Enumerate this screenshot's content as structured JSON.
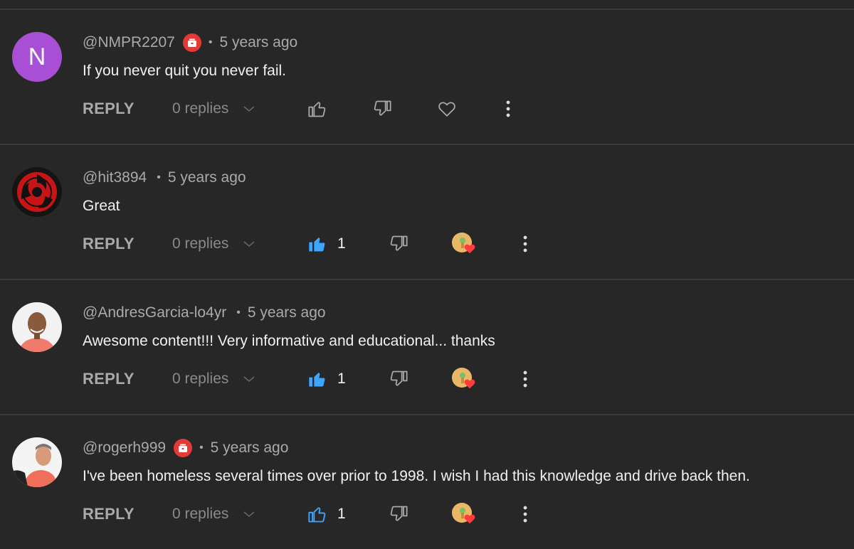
{
  "colors": {
    "background": "#272727",
    "divider": "#3c3c3c",
    "accent_blue": "#3ea6ff",
    "muted_text": "#aaaaaa",
    "badge_red": "#e53935",
    "heart_red": "#ff3b3b"
  },
  "actions": {
    "reply_label": "REPLY",
    "replies_label": "0 replies"
  },
  "comments": [
    {
      "avatar_letter": "N",
      "author": "@NMPR2207",
      "has_badge": true,
      "time": "5 years ago",
      "text": "If you never quit you never fail.",
      "liked": false,
      "like_count": "",
      "hearted": false
    },
    {
      "author": "@hit3894",
      "has_badge": false,
      "time": "5 years ago",
      "text": "Great",
      "liked": true,
      "like_count": "1",
      "hearted": true
    },
    {
      "author": "@AndresGarcia-lo4yr",
      "has_badge": false,
      "time": "5 years ago",
      "text": "Awesome content!!! Very informative and educational... thanks",
      "liked": true,
      "like_count": "1",
      "hearted": true
    },
    {
      "author": "@rogerh999",
      "has_badge": true,
      "time": "5 years ago",
      "text": "I've been homeless several times over prior to 1998.  I wish I had this knowledge and drive back then.",
      "liked": false,
      "like_count": "1",
      "hearted": true
    }
  ]
}
